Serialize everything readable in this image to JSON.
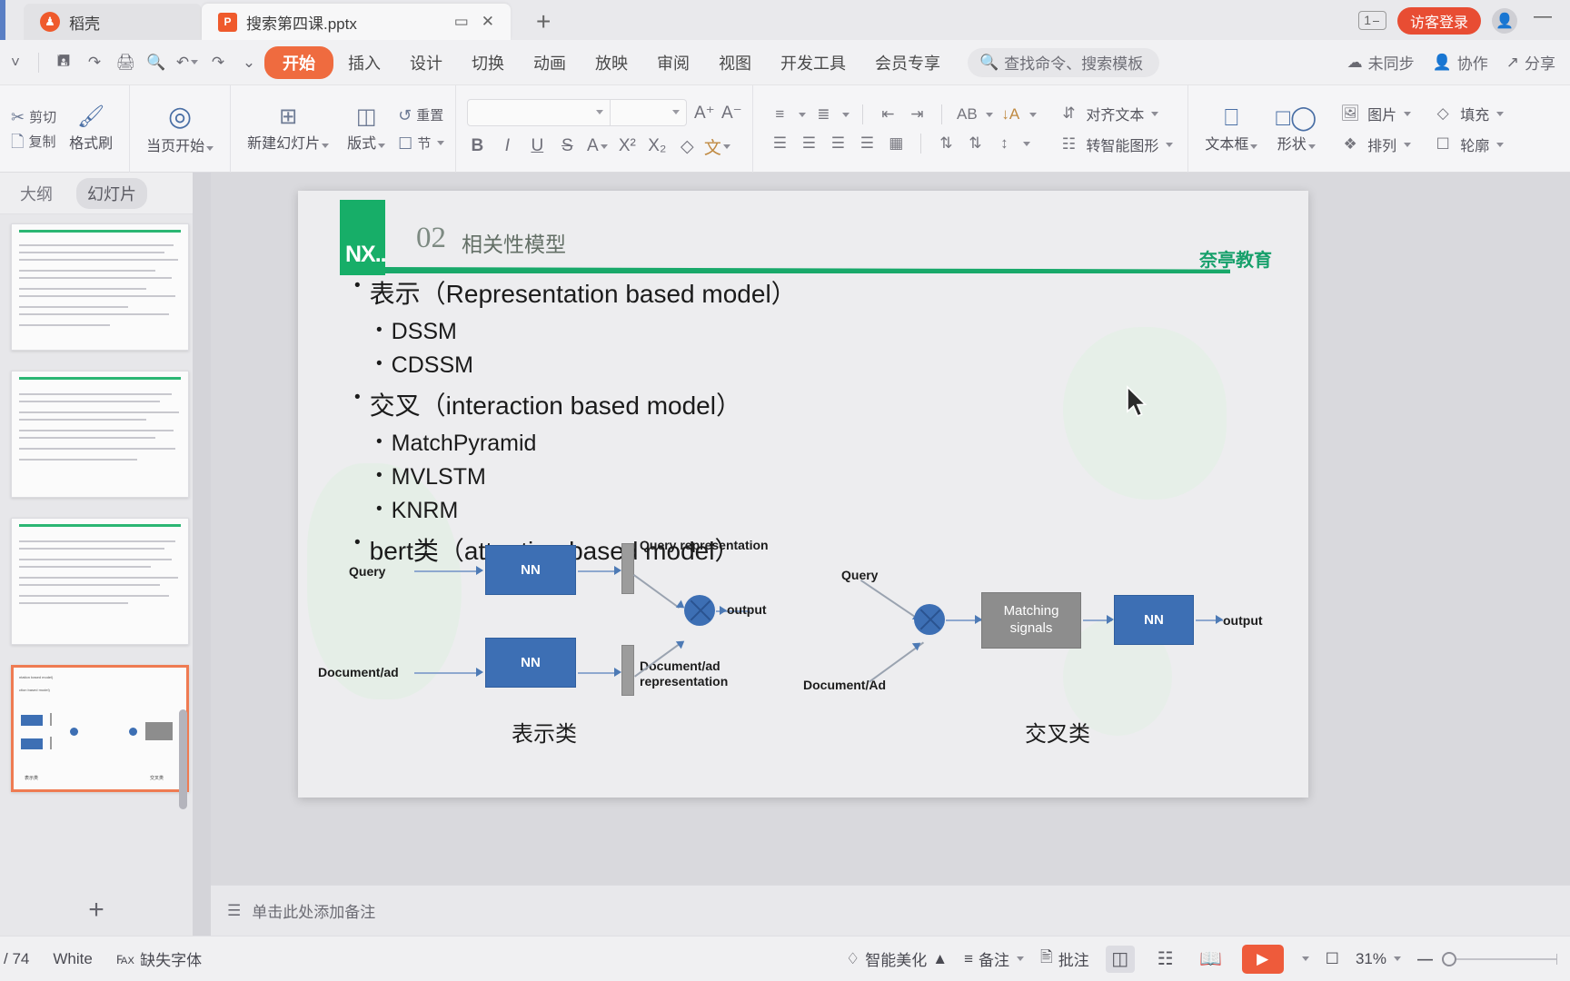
{
  "titlebar": {
    "tabs": [
      {
        "label": "稻壳",
        "icon": "wps-docer-icon",
        "active": false
      },
      {
        "label": "搜索第四课.pptx",
        "icon": "powerpoint-file-icon",
        "active": true
      }
    ],
    "new_tab": "+",
    "restore_label": "▭",
    "close_label": "✕",
    "window_count": "1",
    "login_label": "访客登录",
    "minimize_label": "—"
  },
  "ribbon_tabs": {
    "quick_access": [
      "save-icon",
      "save-as-icon",
      "print-icon",
      "print-preview-icon",
      "undo-icon",
      "redo-icon",
      "customize-qat-icon"
    ],
    "tabs": [
      "开始",
      "插入",
      "设计",
      "切换",
      "动画",
      "放映",
      "审阅",
      "视图",
      "开发工具",
      "会员专享"
    ],
    "selected_tab": "开始",
    "search_placeholder": "查找命令、搜索模板",
    "right_items": [
      {
        "label": "未同步",
        "icon": "cloud-sync-icon"
      },
      {
        "label": "协作",
        "icon": "collaborate-icon"
      },
      {
        "label": "分享",
        "icon": "share-icon"
      }
    ]
  },
  "ribbon": {
    "clipboard": {
      "cut": "剪切",
      "copy": "复制",
      "format_painter": "格式刷"
    },
    "slideshow": {
      "label": "当页开始"
    },
    "slides": {
      "new_slide": "新建幻灯片",
      "layout": "版式",
      "section": "节",
      "reset": "重置"
    },
    "font": {
      "name_value": "",
      "name_placeholder": "",
      "size_value": "",
      "size_placeholder": "",
      "grow": "A⁺",
      "shrink": "A⁻",
      "bold": "B",
      "italic": "I",
      "underline": "U",
      "strike": "S",
      "text_color": "A",
      "superscript": "X²",
      "subscript": "X₂",
      "clear_format": "◇",
      "phonetic": "文"
    },
    "paragraph": {
      "bullets": "bullet-list-icon",
      "numbering": "numbered-list-icon",
      "decrease_indent": "decrease-indent-icon",
      "increase_indent": "increase-indent-icon",
      "char_spacing": "AB",
      "text_direction": "A",
      "align_text": "对齐文本",
      "convert_smartart": "转智能图形",
      "align_left": "align-left-icon",
      "align_center": "align-center-icon",
      "align_right": "align-right-icon",
      "align_justify": "align-justify-icon",
      "distribute": "distribute-icon",
      "line_spacing": "line-spacing-icon"
    },
    "insert": {
      "textbox": "文本框",
      "shape": "形状",
      "picture": "图片",
      "arrange": "排列",
      "fill": "填充",
      "outline": "轮廓"
    }
  },
  "panel": {
    "tabs": [
      "大纲",
      "幻灯片"
    ],
    "selected": "幻灯片",
    "add_slide": "+"
  },
  "slide": {
    "section_number": "02",
    "section_title": "相关性模型",
    "logo_text": "NX..",
    "brand": "奈亭教育",
    "bullets": [
      {
        "level": 1,
        "text": "表示（Representation based model）"
      },
      {
        "level": 2,
        "text": "DSSM"
      },
      {
        "level": 2,
        "text": "CDSSM"
      },
      {
        "level": 1,
        "text": "交叉（interaction based model）"
      },
      {
        "level": 2,
        "text": "MatchPyramid"
      },
      {
        "level": 2,
        "text": "MVLSTM"
      },
      {
        "level": 2,
        "text": "KNRM"
      },
      {
        "level": 1,
        "text": "bert类（attention based model）"
      }
    ],
    "diagram": {
      "left": {
        "caption": "表示类",
        "query_label": "Query",
        "document_label": "Document/ad",
        "nn_top": "NN",
        "nn_bottom": "NN",
        "query_rep": "Query representation",
        "doc_rep_line1": "Document/ad",
        "doc_rep_line2": "representation",
        "output": "output"
      },
      "right": {
        "caption": "交叉类",
        "query_label": "Query",
        "document_label": "Document/Ad",
        "matching_line1": "Matching",
        "matching_line2": "signals",
        "nn": "NN",
        "output": "output"
      }
    }
  },
  "notes": {
    "placeholder": "单击此处添加备注",
    "icon": "notes-icon"
  },
  "status": {
    "slide_counter": "/ 74",
    "theme": "White",
    "font_missing": "缺失字体",
    "beautify": "智能美化",
    "notes_btn": "备注",
    "comment_btn": "批注",
    "zoom_value": "31%",
    "zoom_out": "—",
    "fit_icon": "fit-slide-icon",
    "views": [
      "normal-view-icon",
      "slide-sorter-icon",
      "reading-view-icon"
    ],
    "selected_view": "normal-view-icon",
    "play_icon": "play-icon"
  },
  "colors": {
    "accent_orange": "#ee5b3b",
    "brand_green": "#17a06b",
    "diagram_blue": "#3d6fb4",
    "diagram_gray": "#8d8d8d"
  }
}
